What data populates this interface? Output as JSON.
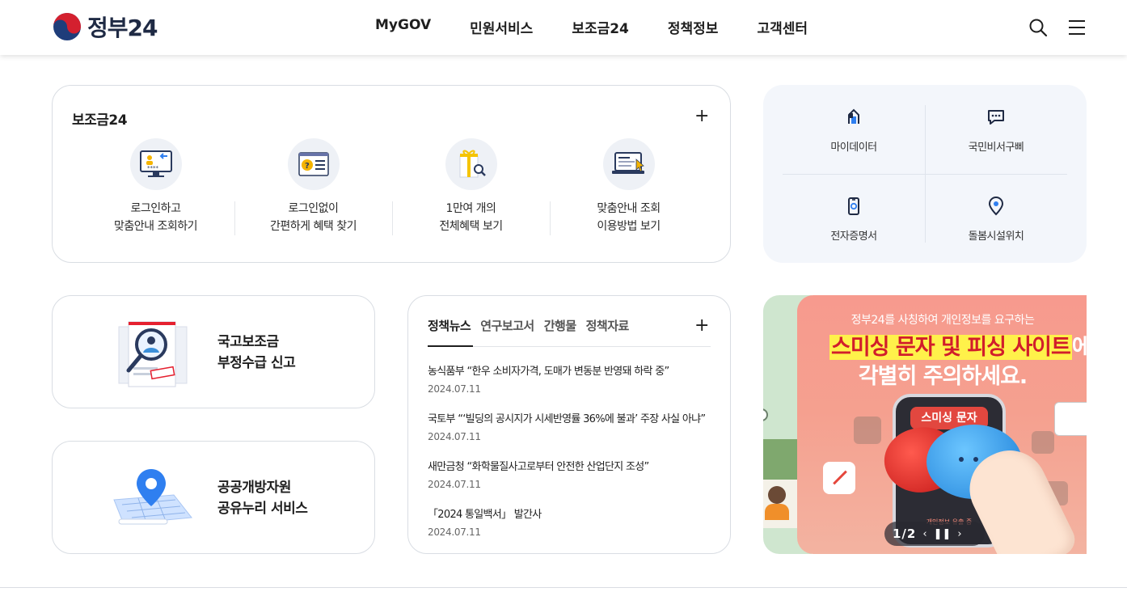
{
  "header": {
    "logo_text": "정부24",
    "nav": [
      "MyGOV",
      "민원서비스",
      "보조금24",
      "정책정보",
      "고객센터"
    ]
  },
  "subsidy": {
    "title": "보조금24",
    "more": "+",
    "items": [
      {
        "label": "로그인하고\n맞춤안내 조회하기"
      },
      {
        "label": "로그인없이\n간편하게 혜택 찾기"
      },
      {
        "label": "1만여 개의\n전체혜택 보기"
      },
      {
        "label": "맞춤안내 조회\n이용방법 보기"
      }
    ]
  },
  "quick": [
    {
      "label": "마이데이터",
      "icon": "mydata-icon"
    },
    {
      "label": "국민비서구삐",
      "icon": "chat-icon"
    },
    {
      "label": "전자증명서",
      "icon": "certificate-icon"
    },
    {
      "label": "돌봄시설위치",
      "icon": "location-pin-icon"
    }
  ],
  "services": [
    {
      "title": "국고보조금\n부정수급 신고"
    },
    {
      "title": "공공개방자원\n공유누리 서비스"
    }
  ],
  "news": {
    "tabs": [
      "정책뉴스",
      "연구보고서",
      "간행물",
      "정책자료"
    ],
    "more": "+",
    "items": [
      {
        "title": "농식품부 “한우 소비자가격, 도매가 변동분 반영돼 하락 중”",
        "date": "2024.07.11"
      },
      {
        "title": "국토부 “‘빌딩의 공시지가 시세반영률 36%에 불과’ 주장 사실 아냐”",
        "date": "2024.07.11"
      },
      {
        "title": "새만금청 “화학물질사고로부터 안전한 산업단지 조성”",
        "date": "2024.07.11"
      },
      {
        "title": "「2024 통일백서」 발간사",
        "date": "2024.07.11"
      }
    ]
  },
  "banner": {
    "top_text": "정부24를 사칭하여 개인정보를 요구하는",
    "headline_highlight": "스미싱 문자 및 피싱 사이트",
    "headline_rest": "에",
    "headline_line2": "각별히 주의하세요.",
    "phone_label": "스미싱 문자",
    "phone_small": "개인정보 유출 중",
    "pager": "1/2"
  },
  "colors": {
    "brand_navy": "#1f2a44",
    "brand_red": "#e2473f",
    "accent_blue": "#1e80d8",
    "quick_bg": "#f3f6fb"
  }
}
